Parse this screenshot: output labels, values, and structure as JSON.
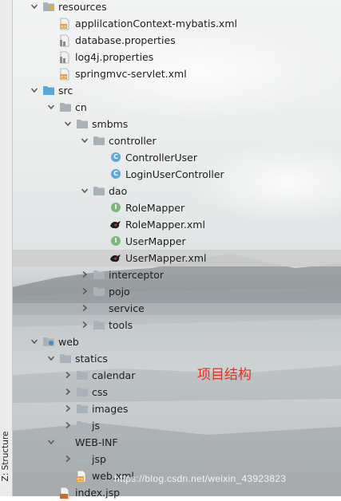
{
  "side_panel": {
    "label": "Z: Structure"
  },
  "tree": [
    {
      "label": "resources",
      "icon": "resources-folder-icon",
      "depth": 1,
      "arrow": "down"
    },
    {
      "label": "applilcationContext-mybatis.xml",
      "icon": "xml-file-icon",
      "depth": 2,
      "arrow": "none"
    },
    {
      "label": "database.properties",
      "icon": "properties-file-icon",
      "depth": 2,
      "arrow": "none"
    },
    {
      "label": "log4j.properties",
      "icon": "properties-file-icon",
      "depth": 2,
      "arrow": "none"
    },
    {
      "label": "springmvc-servlet.xml",
      "icon": "xml-file-icon",
      "depth": 2,
      "arrow": "none"
    },
    {
      "label": "src",
      "icon": "source-folder-icon",
      "depth": 1,
      "arrow": "down"
    },
    {
      "label": "cn",
      "icon": "package-icon",
      "depth": 2,
      "arrow": "down"
    },
    {
      "label": "smbms",
      "icon": "package-icon",
      "depth": 3,
      "arrow": "down"
    },
    {
      "label": "controller",
      "icon": "package-icon",
      "depth": 4,
      "arrow": "down"
    },
    {
      "label": "ControllerUser",
      "icon": "class-icon",
      "depth": 5,
      "arrow": "none"
    },
    {
      "label": "LoginUserController",
      "icon": "class-icon",
      "depth": 5,
      "arrow": "none"
    },
    {
      "label": "dao",
      "icon": "package-icon",
      "depth": 4,
      "arrow": "down"
    },
    {
      "label": "RoleMapper",
      "icon": "interface-icon",
      "depth": 5,
      "arrow": "none"
    },
    {
      "label": "RoleMapper.xml",
      "icon": "mybatis-xml-icon",
      "depth": 5,
      "arrow": "none"
    },
    {
      "label": "UserMapper",
      "icon": "interface-icon",
      "depth": 5,
      "arrow": "none"
    },
    {
      "label": "UserMapper.xml",
      "icon": "mybatis-xml-icon",
      "depth": 5,
      "arrow": "none",
      "selected": true
    },
    {
      "label": "interceptor",
      "icon": "package-icon",
      "depth": 4,
      "arrow": "right"
    },
    {
      "label": "pojo",
      "icon": "package-icon",
      "depth": 4,
      "arrow": "right"
    },
    {
      "label": "service",
      "icon": "package-icon",
      "depth": 4,
      "arrow": "right"
    },
    {
      "label": "tools",
      "icon": "package-icon",
      "depth": 4,
      "arrow": "right"
    },
    {
      "label": "web",
      "icon": "web-folder-icon",
      "depth": 1,
      "arrow": "down"
    },
    {
      "label": "statics",
      "icon": "folder-icon",
      "depth": 2,
      "arrow": "down"
    },
    {
      "label": "calendar",
      "icon": "folder-icon",
      "depth": 3,
      "arrow": "right"
    },
    {
      "label": "css",
      "icon": "folder-icon",
      "depth": 3,
      "arrow": "right"
    },
    {
      "label": "images",
      "icon": "folder-icon",
      "depth": 3,
      "arrow": "right"
    },
    {
      "label": "js",
      "icon": "folder-icon",
      "depth": 3,
      "arrow": "right"
    },
    {
      "label": "WEB-INF",
      "icon": "folder-icon",
      "depth": 2,
      "arrow": "down"
    },
    {
      "label": "jsp",
      "icon": "folder-icon",
      "depth": 3,
      "arrow": "right"
    },
    {
      "label": "web.xml",
      "icon": "xml-file-icon",
      "depth": 3,
      "arrow": "none"
    },
    {
      "label": "index.jsp",
      "icon": "jsp-file-icon",
      "depth": 2,
      "arrow": "none"
    }
  ],
  "annotation": {
    "text": "项目结构"
  },
  "watermark": {
    "text": "https://blog.csdn.net/weixin_43923823"
  },
  "colors": {
    "selection": "#cdcdcd",
    "folder": "#a9b2b9",
    "source_folder": "#5aa8d6",
    "class": "#61a6d6",
    "interface": "#7cb87a",
    "annotation": "#e03424"
  }
}
